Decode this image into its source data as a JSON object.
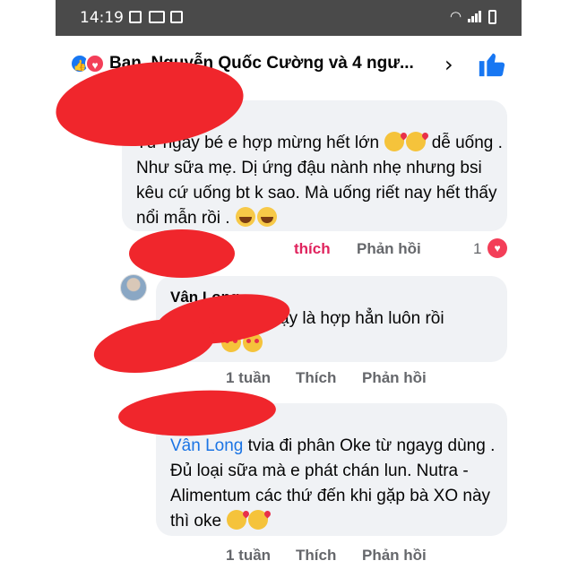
{
  "status_bar": {
    "time": "14:19"
  },
  "reactions_header": {
    "reactors": "Bạn, Nguyễn Quốc Cường và 4 ngư...",
    "chevron": "›",
    "like_icon": "thumbs-up-icon"
  },
  "comments": [
    {
      "text": "Từ ngày bé e hợp mừng hết lớn",
      "text_2": "dễ uống . Như sữa mẹ. Dị ứng đậu nành nhẹ nhưng bsi kêu cứ uống bt k sao. Mà uống riết nay hết thấy nổi mẫn rồi .",
      "emoji": [
        "kissing-heart-emoji",
        "laughing-tears-emoji"
      ],
      "actions": {
        "like": "thích",
        "reply": "Phản hồi"
      },
      "reaction_count": "1"
    },
    {
      "author": "Vân Long",
      "text": "ậy là hợp hẳn luôn rồi",
      "actions": {
        "time": "1 tuần",
        "like": "Thích",
        "reply": "Phản hồi"
      }
    },
    {
      "author": "Vân Long",
      "text": "tvia đi phân Oke từ ngayg dùng . Đủ loại sữa mà e phát chán lun. Nutra - Alimentum các thứ đến khi gặp bà XO này thì oke",
      "actions": {
        "time": "1 tuần",
        "like": "Thích",
        "reply": "Phản hồi"
      }
    }
  ],
  "colors": {
    "status_bar": "#4a4a4a",
    "bubble": "#f0f2f5",
    "link": "#1b74e4",
    "like_blue": "#1877f2",
    "heart_red": "#f33e58",
    "redaction": "#f0262c"
  }
}
